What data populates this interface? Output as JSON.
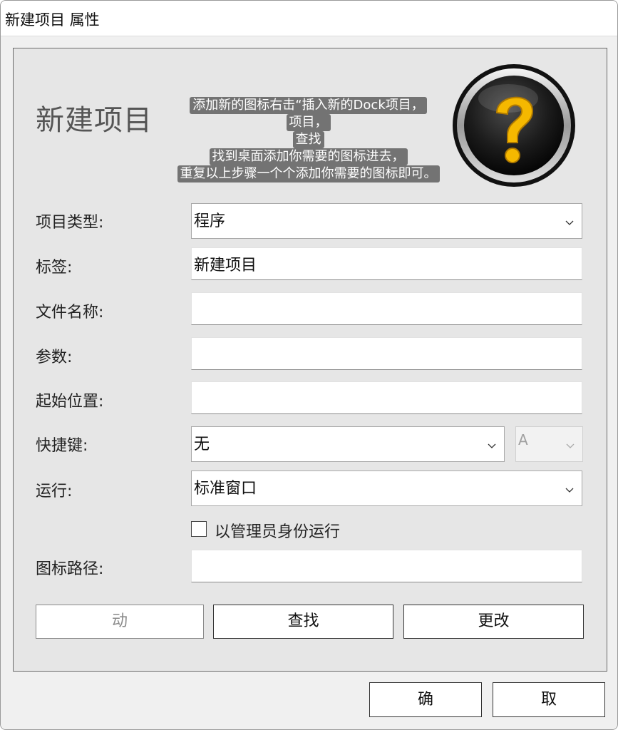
{
  "window": {
    "title": "新建项目 属性"
  },
  "header": {
    "title": "新建项目",
    "tooltip_lines": [
      "添加新的图标右击“插入新的Dock项目，",
      "项目，",
      "查找",
      "找到桌面添加你需要的图标进去，",
      "重复以上步骤一个个添加你需要的图标即可。"
    ],
    "icon": "help-question-icon",
    "icon_colors": {
      "glyph": "#f5b800",
      "ball": "#1a1a1a",
      "ring": "#c8c8c8"
    }
  },
  "form": {
    "item_type": {
      "label": "项目类型:",
      "value": "程序"
    },
    "tag": {
      "label": "标签:",
      "value": "新建项目"
    },
    "filename": {
      "label": "文件名称:",
      "value": ""
    },
    "params": {
      "label": "参数:",
      "value": ""
    },
    "start_pos": {
      "label": "起始位置:",
      "value": ""
    },
    "hotkey": {
      "label": "快捷键:",
      "value": "无",
      "key_value": "A"
    },
    "run": {
      "label": "运行:",
      "value": "标准窗口"
    },
    "run_as_admin": {
      "label": "以管理员身份运行",
      "checked": false
    },
    "icon_path": {
      "label": "图标路径:",
      "value": ""
    }
  },
  "buttons": {
    "action": "动",
    "browse": "查找",
    "change": "更改",
    "ok": "确",
    "cancel": "取"
  }
}
